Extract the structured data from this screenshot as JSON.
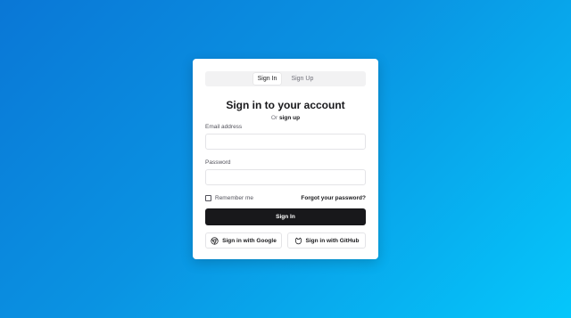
{
  "tabs": [
    {
      "label": "Sign In",
      "active": true
    },
    {
      "label": "Sign Up",
      "active": false
    }
  ],
  "heading": "Sign in to your account",
  "subline": {
    "prefix": "Or",
    "link": "sign up"
  },
  "form": {
    "email_label": "Email address",
    "email_value": "",
    "email_placeholder": "",
    "password_label": "Password",
    "password_value": "",
    "password_placeholder": "",
    "remember_label": "Remember me",
    "remember_checked": false,
    "forgot_label": "Forgot your password?",
    "submit_label": "Sign In"
  },
  "social": {
    "google_label": "Sign in with Google",
    "google_icon": "chrome-icon",
    "github_label": "Sign in with GitHub",
    "github_icon": "github-icon"
  },
  "colors": {
    "background_start": "#0a77d6",
    "background_end": "#05c7fb",
    "primary_button": "#18181b",
    "card": "#ffffff"
  }
}
